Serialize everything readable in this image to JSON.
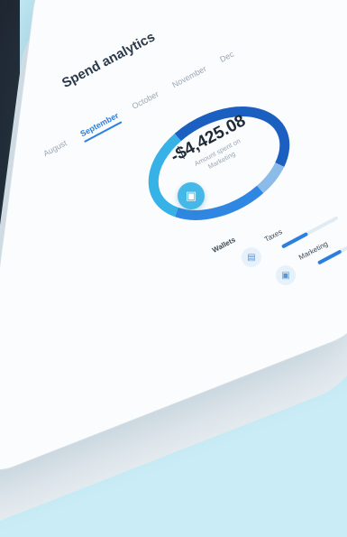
{
  "screen": {
    "title": "Spend analytics",
    "months": [
      "August",
      "September",
      "October",
      "November",
      "Dec"
    ],
    "active_month_index": 1
  },
  "summary": {
    "amount": "-$4,425.08",
    "caption_line1": "Amount spent on",
    "caption_line2": "Marketing",
    "segments": [
      {
        "color": "#1b5fc1",
        "fraction": 0.42
      },
      {
        "color": "#8bbbe9",
        "fraction": 0.08
      },
      {
        "color": "#2f87e1",
        "fraction": 0.22
      },
      {
        "color": "#37b2e6",
        "fraction": 0.28
      }
    ]
  },
  "wallet_badge": {
    "icon": "wallet-icon"
  },
  "categories_section": {
    "label": "Wallets",
    "items": [
      {
        "label": "Taxes",
        "icon": "receipt-icon",
        "progress": 0.45
      },
      {
        "label": "Marketing",
        "icon": "wallet-icon",
        "progress": 0.6
      }
    ]
  }
}
